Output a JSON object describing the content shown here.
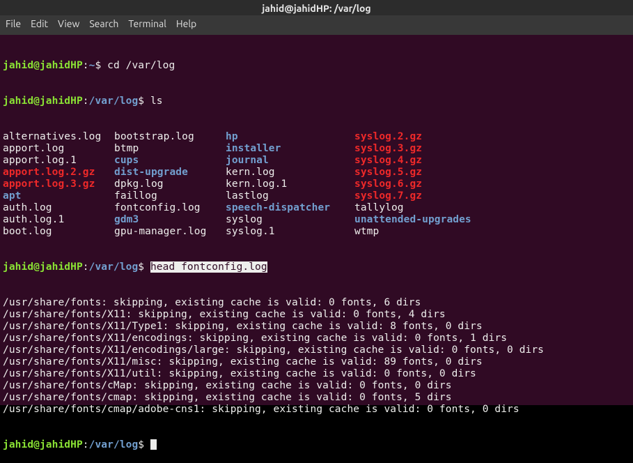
{
  "titlebar": "jahid@jahidHP: /var/log",
  "menu": {
    "file": "File",
    "edit": "Edit",
    "view": "View",
    "search": "Search",
    "terminal": "Terminal",
    "help": "Help"
  },
  "prompt": {
    "userhost": "jahid@jahidHP",
    "homesym": ":~",
    "dirsym": ":",
    "dollar": "$ "
  },
  "lines": {
    "p1_path": "~",
    "p1_cmd": "cd /var/log",
    "p2_path": "/var/log",
    "p2_cmd": "ls",
    "ls": [
      {
        "c1": {
          "t": "alternatives.log",
          "cls": "file-plain"
        },
        "c2": {
          "t": "bootstrap.log",
          "cls": "file-plain"
        },
        "c3": {
          "t": "hp",
          "cls": "file-dir"
        },
        "c4": {
          "t": "syslog.2.gz",
          "cls": "file-archive"
        }
      },
      {
        "c1": {
          "t": "apport.log",
          "cls": "file-plain"
        },
        "c2": {
          "t": "btmp",
          "cls": "file-plain"
        },
        "c3": {
          "t": "installer",
          "cls": "file-dir"
        },
        "c4": {
          "t": "syslog.3.gz",
          "cls": "file-archive"
        }
      },
      {
        "c1": {
          "t": "apport.log.1",
          "cls": "file-plain"
        },
        "c2": {
          "t": "cups",
          "cls": "file-dir"
        },
        "c3": {
          "t": "journal",
          "cls": "file-dir"
        },
        "c4": {
          "t": "syslog.4.gz",
          "cls": "file-archive"
        }
      },
      {
        "c1": {
          "t": "apport.log.2.gz",
          "cls": "file-archive"
        },
        "c2": {
          "t": "dist-upgrade",
          "cls": "file-dir"
        },
        "c3": {
          "t": "kern.log",
          "cls": "file-plain"
        },
        "c4": {
          "t": "syslog.5.gz",
          "cls": "file-archive"
        }
      },
      {
        "c1": {
          "t": "apport.log.3.gz",
          "cls": "file-archive"
        },
        "c2": {
          "t": "dpkg.log",
          "cls": "file-plain"
        },
        "c3": {
          "t": "kern.log.1",
          "cls": "file-plain"
        },
        "c4": {
          "t": "syslog.6.gz",
          "cls": "file-archive"
        }
      },
      {
        "c1": {
          "t": "apt",
          "cls": "file-dir"
        },
        "c2": {
          "t": "faillog",
          "cls": "file-plain"
        },
        "c3": {
          "t": "lastlog",
          "cls": "file-plain"
        },
        "c4": {
          "t": "syslog.7.gz",
          "cls": "file-archive"
        }
      },
      {
        "c1": {
          "t": "auth.log",
          "cls": "file-plain"
        },
        "c2": {
          "t": "fontconfig.log",
          "cls": "file-plain"
        },
        "c3": {
          "t": "speech-dispatcher",
          "cls": "file-dir"
        },
        "c4": {
          "t": "tallylog",
          "cls": "file-plain"
        }
      },
      {
        "c1": {
          "t": "auth.log.1",
          "cls": "file-plain"
        },
        "c2": {
          "t": "gdm3",
          "cls": "file-dir"
        },
        "c3": {
          "t": "syslog",
          "cls": "file-plain"
        },
        "c4": {
          "t": "unattended-upgrades",
          "cls": "file-dir"
        }
      },
      {
        "c1": {
          "t": "boot.log",
          "cls": "file-plain"
        },
        "c2": {
          "t": "gpu-manager.log",
          "cls": "file-plain"
        },
        "c3": {
          "t": "syslog.1",
          "cls": "file-plain"
        },
        "c4": {
          "t": "wtmp",
          "cls": "file-plain"
        }
      }
    ],
    "p3_path": "/var/log",
    "p3_cmd": "head fontconfig.log",
    "out": [
      "/usr/share/fonts: skipping, existing cache is valid: 0 fonts, 6 dirs",
      "/usr/share/fonts/X11: skipping, existing cache is valid: 0 fonts, 4 dirs",
      "/usr/share/fonts/X11/Type1: skipping, existing cache is valid: 8 fonts, 0 dirs",
      "/usr/share/fonts/X11/encodings: skipping, existing cache is valid: 0 fonts, 1 dirs",
      "/usr/share/fonts/X11/encodings/large: skipping, existing cache is valid: 0 fonts, 0 dirs",
      "/usr/share/fonts/X11/misc: skipping, existing cache is valid: 89 fonts, 0 dirs",
      "/usr/share/fonts/X11/util: skipping, existing cache is valid: 0 fonts, 0 dirs",
      "/usr/share/fonts/cMap: skipping, existing cache is valid: 0 fonts, 0 dirs",
      "/usr/share/fonts/cmap: skipping, existing cache is valid: 0 fonts, 5 dirs",
      "/usr/share/fonts/cmap/adobe-cns1: skipping, existing cache is valid: 0 fonts, 0 dirs"
    ],
    "p4_path": "/var/log"
  }
}
